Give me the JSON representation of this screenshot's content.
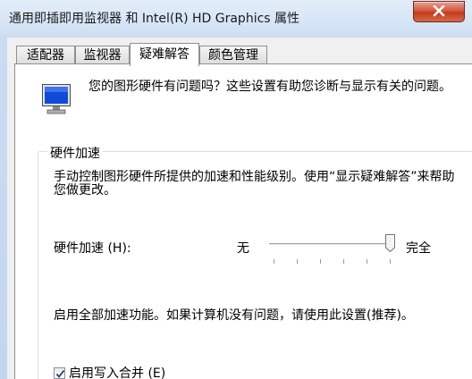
{
  "window": {
    "title": "通用即插即用监视器 和 Intel(R) HD Graphics 属性",
    "close_icon": "close-icon"
  },
  "tabs": [
    {
      "label": "适配器"
    },
    {
      "label": "监视器"
    },
    {
      "label": "疑难解答",
      "selected": true
    },
    {
      "label": "颜色管理"
    }
  ],
  "troubleshoot": {
    "icon": "monitor-icon",
    "intro": "您的图形硬件有问题吗？这些设置有助您诊断与显示有关的问题。",
    "group_title": "硬件加速",
    "description": "手动控制图形硬件所提供的加速和性能级别。使用“显示疑难解答”来帮助您做更改。",
    "accel_label": "硬件加速 (H):",
    "min_label": "无",
    "max_label": "完全",
    "slider_level": 1.0,
    "slider_ticks": 6,
    "status": "启用全部加速功能。如果计算机没有问题，请使用此设置(推荐)。",
    "checkbox_label": "启用写入合并 (E)",
    "checkbox_checked": true
  }
}
